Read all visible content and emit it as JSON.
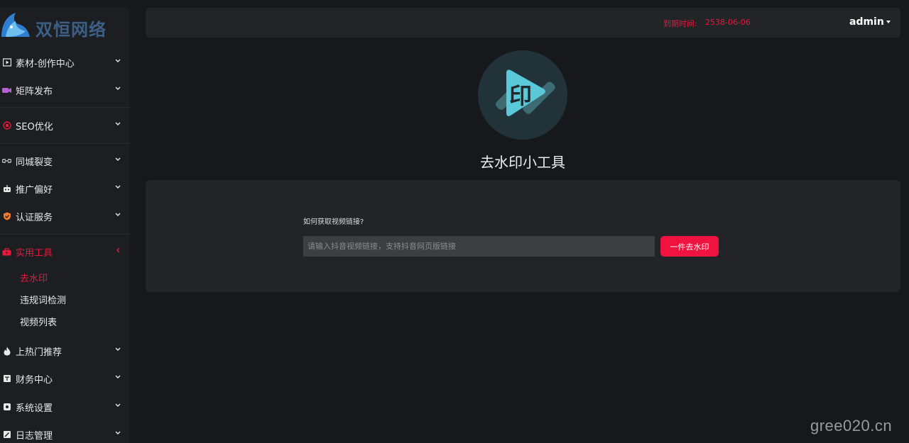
{
  "brand": {
    "logo_text": "双恒网络"
  },
  "header": {
    "expire_label": "到期时间:",
    "expire_value": "2538-06-06",
    "user": "admin"
  },
  "sidebar": {
    "items": [
      {
        "label": "素材-创作中心",
        "icon": "video-frame-icon",
        "color": "#e9e9e9"
      },
      {
        "label": "矩阵发布",
        "icon": "camera-icon",
        "color": "#b65fd6"
      },
      {
        "label": "SEO优化",
        "icon": "seo-badge-icon",
        "color": "#e4193b"
      },
      {
        "label": "同城裂变",
        "icon": "link-icon",
        "color": "#e9e9e9"
      },
      {
        "label": "推广偏好",
        "icon": "robot-icon",
        "color": "#e9e9e9"
      },
      {
        "label": "认证服务",
        "icon": "shield-icon",
        "color": "#f07b2f"
      },
      {
        "label": "实用工具",
        "icon": "toolbox-icon",
        "color": "#e4193b"
      },
      {
        "label": "上热门推荐",
        "icon": "fire-icon",
        "color": "#e9e9e9"
      },
      {
        "label": "财务中心",
        "icon": "wallet-icon",
        "color": "#e9e9e9"
      },
      {
        "label": "系统设置",
        "icon": "gear-icon",
        "color": "#e9e9e9"
      },
      {
        "label": "日志管理",
        "icon": "log-icon",
        "color": "#e9e9e9"
      }
    ],
    "sub_items": [
      {
        "label": "去水印",
        "active": true
      },
      {
        "label": "违规词检测",
        "active": false
      },
      {
        "label": "视频列表",
        "active": false
      }
    ]
  },
  "tool": {
    "logo_glyph": "印",
    "title": "去水印小工具",
    "how_link": "如何获取视频链接?",
    "input_placeholder": "请输入抖音视频链接，支持抖音网页版链接",
    "button_label": "一件去水印"
  },
  "watermark": "gree020.cn",
  "colors": {
    "accent": "#e4193b",
    "button": "#f0123f",
    "tool_logo_bg": "#213338",
    "tool_logo_fg": "#5ac8d8"
  }
}
